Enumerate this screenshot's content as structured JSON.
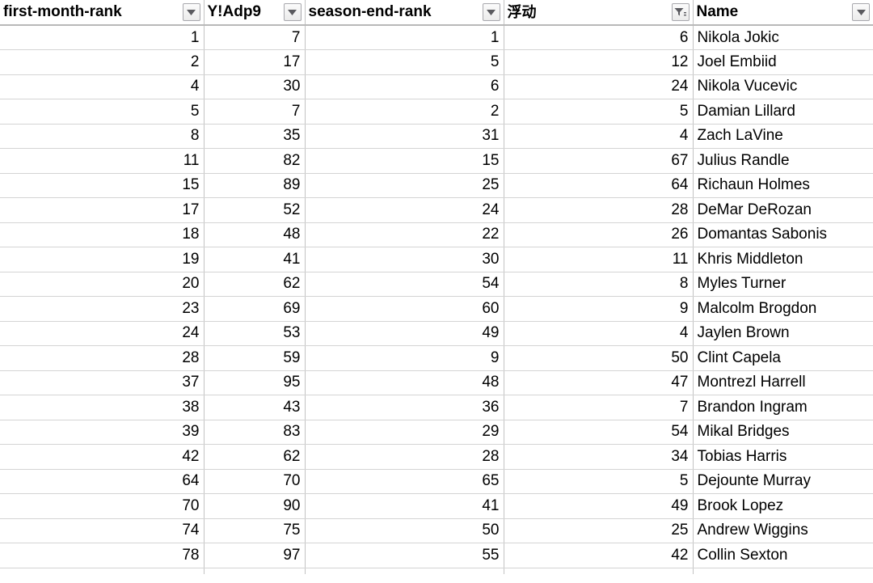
{
  "table": {
    "columns": [
      {
        "label": "first-month-rank",
        "align": "num",
        "filter_icon": "chevron-down-icon",
        "filtered": false
      },
      {
        "label": "Y!Adp9",
        "align": "num",
        "filter_icon": "chevron-down-icon",
        "filtered": false
      },
      {
        "label": "season-end-rank",
        "align": "num",
        "filter_icon": "chevron-down-icon",
        "filtered": false
      },
      {
        "label": "浮动",
        "align": "num",
        "filter_icon": "funnel-filter-icon",
        "filtered": true
      },
      {
        "label": "Name",
        "align": "txt",
        "filter_icon": "chevron-down-icon",
        "filtered": false
      }
    ],
    "rows": [
      [
        "1",
        "7",
        "1",
        "6",
        "Nikola Jokic"
      ],
      [
        "2",
        "17",
        "5",
        "12",
        "Joel Embiid"
      ],
      [
        "4",
        "30",
        "6",
        "24",
        "Nikola Vucevic"
      ],
      [
        "5",
        "7",
        "2",
        "5",
        "Damian Lillard"
      ],
      [
        "8",
        "35",
        "31",
        "4",
        "Zach LaVine"
      ],
      [
        "11",
        "82",
        "15",
        "67",
        "Julius Randle"
      ],
      [
        "15",
        "89",
        "25",
        "64",
        "Richaun Holmes"
      ],
      [
        "17",
        "52",
        "24",
        "28",
        "DeMar DeRozan"
      ],
      [
        "18",
        "48",
        "22",
        "26",
        "Domantas Sabonis"
      ],
      [
        "19",
        "41",
        "30",
        "11",
        "Khris Middleton"
      ],
      [
        "20",
        "62",
        "54",
        "8",
        "Myles Turner"
      ],
      [
        "23",
        "69",
        "60",
        "9",
        "Malcolm Brogdon"
      ],
      [
        "24",
        "53",
        "49",
        "4",
        "Jaylen Brown"
      ],
      [
        "28",
        "59",
        "9",
        "50",
        "Clint Capela"
      ],
      [
        "37",
        "95",
        "48",
        "47",
        "Montrezl Harrell"
      ],
      [
        "38",
        "43",
        "36",
        "7",
        "Brandon Ingram"
      ],
      [
        "39",
        "83",
        "29",
        "54",
        "Mikal Bridges"
      ],
      [
        "42",
        "62",
        "28",
        "34",
        "Tobias Harris"
      ],
      [
        "64",
        "70",
        "65",
        "5",
        "Dejounte Murray"
      ],
      [
        "70",
        "90",
        "41",
        "49",
        "Brook Lopez"
      ],
      [
        "74",
        "75",
        "50",
        "25",
        "Andrew Wiggins"
      ],
      [
        "78",
        "97",
        "55",
        "42",
        "Collin Sexton"
      ]
    ]
  },
  "colors": {
    "grid_line": "#d4d4d4",
    "column_line": "#c3c3c3",
    "header_rule": "#b8b8b8",
    "text": "#000000",
    "background": "#ffffff",
    "button_border": "#a8a8ad"
  }
}
